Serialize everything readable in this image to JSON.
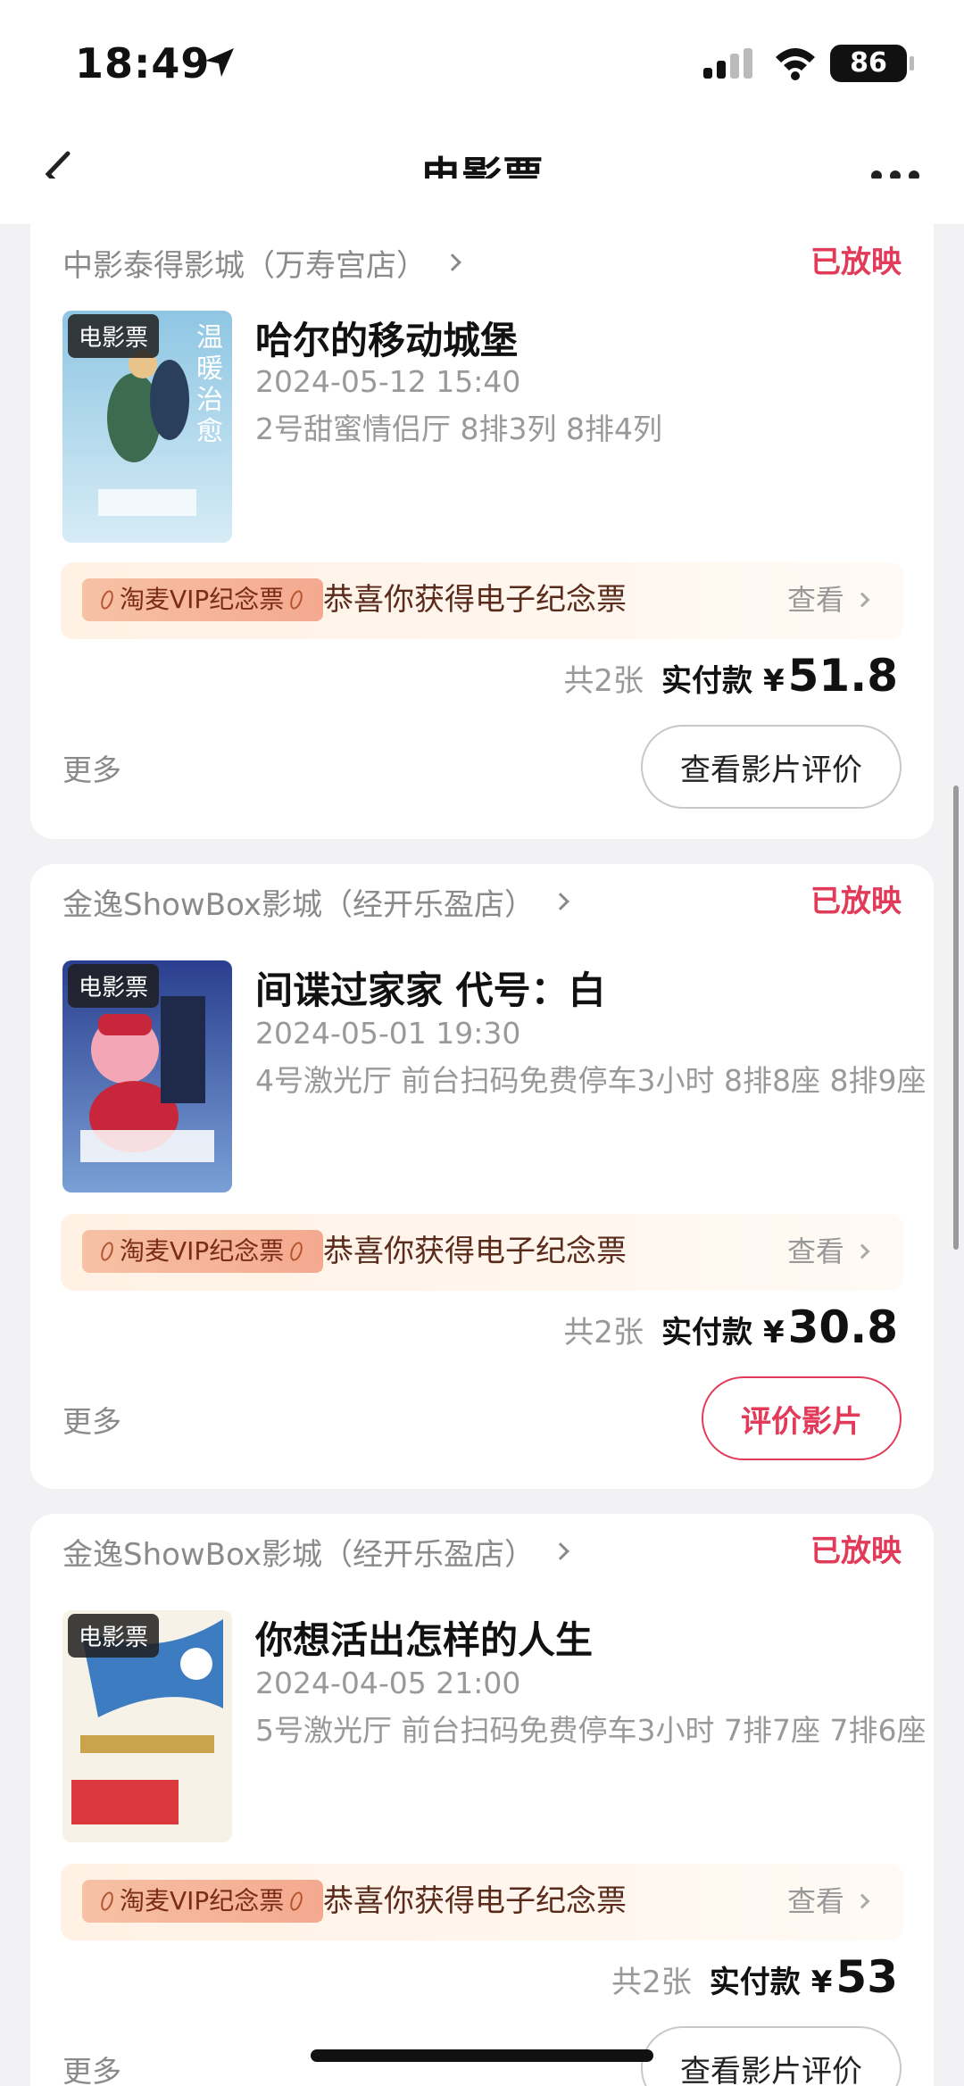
{
  "status_bar": {
    "time": "18:49",
    "battery": "86"
  },
  "nav": {
    "title": "电影票"
  },
  "orders": [
    {
      "cinema": "中影泰得影城（万寿宫店）",
      "status": "已放映",
      "poster_tag": "电影票",
      "movie": "哈尔的移动城堡",
      "datetime": "2024-05-12 15:40",
      "seats": "2号甜蜜情侣厅 8排3列 8排4列",
      "vip_badge": "淘麦VIP纪念票",
      "vip_text": "恭喜你获得电子纪念票",
      "vip_view": "查看",
      "count": "共2张",
      "paid_label": "实付款",
      "currency": "¥",
      "amount": "51.8",
      "more": "更多",
      "action": "查看影片评价"
    },
    {
      "cinema": "金逸ShowBox影城（经开乐盈店）",
      "status": "已放映",
      "poster_tag": "电影票",
      "movie": "间谍过家家 代号：白",
      "datetime": "2024-05-01 19:30",
      "seats": "4号激光厅 前台扫码免费停车3小时 8排8座 8排9座",
      "vip_badge": "淘麦VIP纪念票",
      "vip_text": "恭喜你获得电子纪念票",
      "vip_view": "查看",
      "count": "共2张",
      "paid_label": "实付款",
      "currency": "¥",
      "amount": "30.8",
      "more": "更多",
      "action": "评价影片"
    },
    {
      "cinema": "金逸ShowBox影城（经开乐盈店）",
      "status": "已放映",
      "poster_tag": "电影票",
      "movie": "你想活出怎样的人生",
      "datetime": "2024-04-05 21:00",
      "seats": "5号激光厅 前台扫码免费停车3小时 7排7座 7排6座",
      "vip_badge": "淘麦VIP纪念票",
      "vip_text": "恭喜你获得电子纪念票",
      "vip_view": "查看",
      "count": "共2张",
      "paid_label": "实付款",
      "currency": "¥",
      "amount": "53",
      "more": "更多",
      "action": "查看影片评价"
    }
  ],
  "colors": {
    "accent": "#e23b5a",
    "vip_bg": "#fff1e4"
  }
}
